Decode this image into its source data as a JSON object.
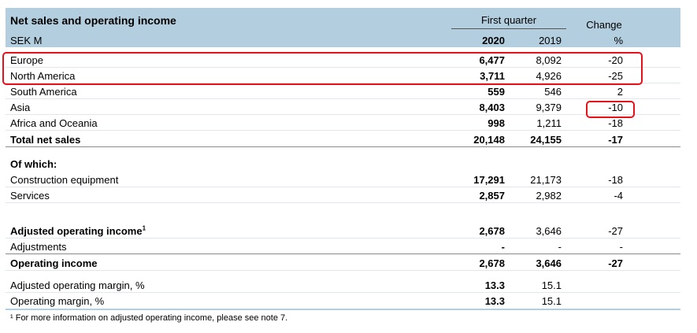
{
  "header": {
    "title": "Net sales and operating income",
    "unit": "SEK M",
    "period_group": "First quarter",
    "change_label": "Change",
    "col_2020": "2020",
    "col_2019": "2019",
    "col_pct": "%"
  },
  "rows": [
    {
      "label": "Europe",
      "v2020": "6,477",
      "v2019": "8,092",
      "change": "-20"
    },
    {
      "label": "North America",
      "v2020": "3,711",
      "v2019": "4,926",
      "change": "-25"
    },
    {
      "label": "South America",
      "v2020": "559",
      "v2019": "546",
      "change": "2"
    },
    {
      "label": "Asia",
      "v2020": "8,403",
      "v2019": "9,379",
      "change": "-10"
    },
    {
      "label": "Africa and Oceania",
      "v2020": "998",
      "v2019": "1,211",
      "change": "-18"
    },
    {
      "label": "Total net sales",
      "v2020": "20,148",
      "v2019": "24,155",
      "change": "-17"
    },
    {
      "label": "Of which:",
      "v2020": "",
      "v2019": "",
      "change": ""
    },
    {
      "label": "Construction equipment",
      "v2020": "17,291",
      "v2019": "21,173",
      "change": "-18"
    },
    {
      "label": "Services",
      "v2020": "2,857",
      "v2019": "2,982",
      "change": "-4"
    },
    {
      "label": "Adjusted operating income",
      "sup": "1",
      "v2020": "2,678",
      "v2019": "3,646",
      "change": "-27"
    },
    {
      "label": "Adjustments",
      "v2020": "-",
      "v2019": "-",
      "change": "-"
    },
    {
      "label": "Operating income",
      "v2020": "2,678",
      "v2019": "3,646",
      "change": "-27"
    },
    {
      "label": "Adjusted operating margin, %",
      "v2020": "13.3",
      "v2019": "15.1",
      "change": ""
    },
    {
      "label": "Operating margin, %",
      "v2020": "13.3",
      "v2019": "15.1",
      "change": ""
    }
  ],
  "footnote": "¹ For more information on adjusted operating income, please see note 7.",
  "colors": {
    "header_bg": "#b3cede",
    "highlight": "#e8101a"
  }
}
